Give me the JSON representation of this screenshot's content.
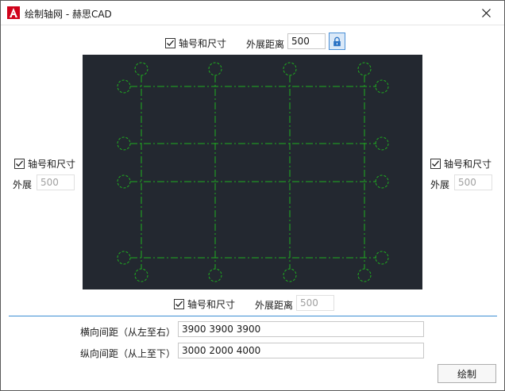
{
  "window": {
    "title": "绘制轴网 - 赫思CAD"
  },
  "top": {
    "checkbox_label": "轴号和尺寸",
    "checked": true,
    "offset_label": "外展距离",
    "offset_value": "500"
  },
  "left": {
    "checkbox_label": "轴号和尺寸",
    "checked": true,
    "offset_label": "外展",
    "offset_value": "500"
  },
  "right": {
    "checkbox_label": "轴号和尺寸",
    "checked": true,
    "offset_label": "外展",
    "offset_value": "500"
  },
  "bottom": {
    "checkbox_label": "轴号和尺寸",
    "checked": true,
    "offset_label": "外展距离",
    "offset_value": "500"
  },
  "spacing": {
    "horizontal_label": "横向间距（从左至右）",
    "horizontal_value": "3900 3900 3900",
    "vertical_label": "纵向间距（从上至下）",
    "vertical_value": "3000 2000 4000"
  },
  "actions": {
    "draw_label": "绘制"
  },
  "colors": {
    "preview_background": "#232830",
    "grid_line": "#1fae1f",
    "accent": "#3c8fd4",
    "app_icon": "#d0021b"
  },
  "icons": {
    "app": "autocad-a-icon",
    "close": "close-icon",
    "lock": "lock-icon",
    "check": "checkmark-icon"
  }
}
